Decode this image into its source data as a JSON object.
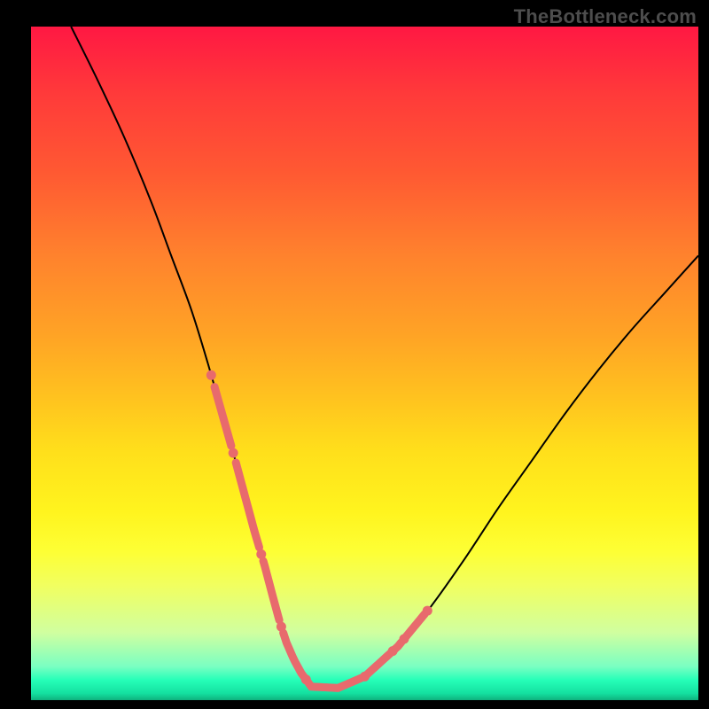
{
  "watermark": "TheBottleneck.com",
  "colors": {
    "background": "#000000",
    "curve": "#000000",
    "highlight": "#e86a6d"
  },
  "chart_data": {
    "type": "line",
    "title": "",
    "xlabel": "",
    "ylabel": "",
    "xlim": [
      0,
      100
    ],
    "ylim": [
      0,
      100
    ],
    "grid": false,
    "legend": false,
    "note": "Axes are unlabeled; x and y below are in percent of plot width/height, y measured from bottom. Values read from pixel positions.",
    "series": [
      {
        "name": "curve",
        "x": [
          6,
          10,
          14,
          18,
          21,
          24,
          26.5,
          28.5,
          30.5,
          32,
          33.5,
          35,
          36.2,
          37.3,
          38.3,
          39.4,
          40.5,
          42,
          46,
          50,
          55,
          60,
          65,
          70,
          75,
          80,
          85,
          90,
          95,
          100
        ],
        "y": [
          100,
          92,
          83.5,
          74,
          66,
          58,
          50,
          43,
          36,
          30.5,
          25,
          20,
          15.5,
          11.5,
          8.5,
          6,
          4,
          2,
          1.8,
          3.5,
          8,
          14,
          21,
          28.5,
          35.5,
          42.5,
          49,
          55,
          60.5,
          66
        ]
      }
    ],
    "highlight_ranges": {
      "note": "x ranges (percent) where the curve is overlaid with salmon-colored marks",
      "ranges": [
        [
          27.5,
          30.0
        ],
        [
          30.7,
          34.2
        ],
        [
          34.8,
          37.2
        ],
        [
          37.8,
          41.0
        ],
        [
          41.5,
          49.5
        ],
        [
          50.2,
          54.0
        ],
        [
          54.5,
          55.5
        ],
        [
          56.2,
          59.0
        ]
      ]
    },
    "highlight_dots_x": [
      27.0,
      30.3,
      34.5,
      37.5,
      41.2,
      50.0,
      54.2,
      55.9,
      59.4
    ]
  }
}
